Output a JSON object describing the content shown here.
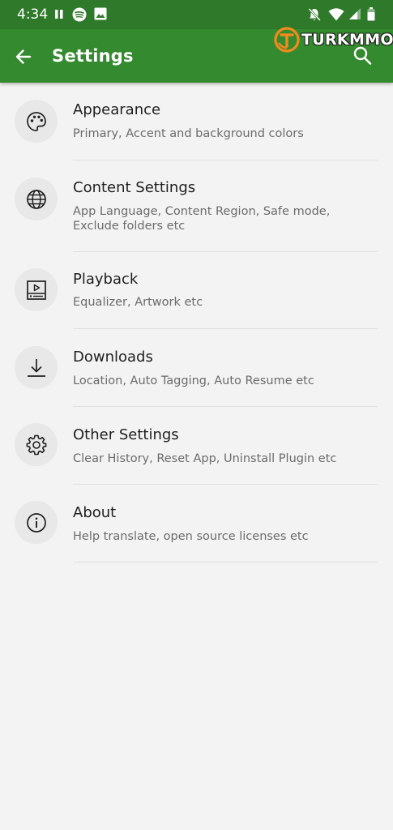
{
  "status_bar": {
    "time": "4:34",
    "left_icons": [
      "pause-icon",
      "spotify-icon",
      "image-icon"
    ],
    "right_icons": [
      "notifications-off-icon",
      "wifi-icon",
      "signal-icon",
      "battery-icon"
    ]
  },
  "app_bar": {
    "title": "Settings",
    "back_icon": "arrow-back-icon",
    "search_icon": "search-icon",
    "color": "#348a2f"
  },
  "watermark": {
    "text": "TURKMMO"
  },
  "settings": [
    {
      "title": "Appearance",
      "subtitle": "Primary, Accent and background colors",
      "icon": "palette-icon"
    },
    {
      "title": "Content Settings",
      "subtitle": "App Language, Content Region, Safe mode, Exclude folders etc",
      "icon": "globe-icon"
    },
    {
      "title": "Playback",
      "subtitle": "Equalizer, Artwork etc",
      "icon": "playback-icon"
    },
    {
      "title": "Downloads",
      "subtitle": "Location, Auto Tagging, Auto Resume etc",
      "icon": "download-icon"
    },
    {
      "title": "Other Settings",
      "subtitle": "Clear History, Reset App, Uninstall Plugin etc",
      "icon": "gear-icon"
    },
    {
      "title": "About",
      "subtitle": "Help translate, open source licenses etc",
      "icon": "info-icon"
    }
  ]
}
